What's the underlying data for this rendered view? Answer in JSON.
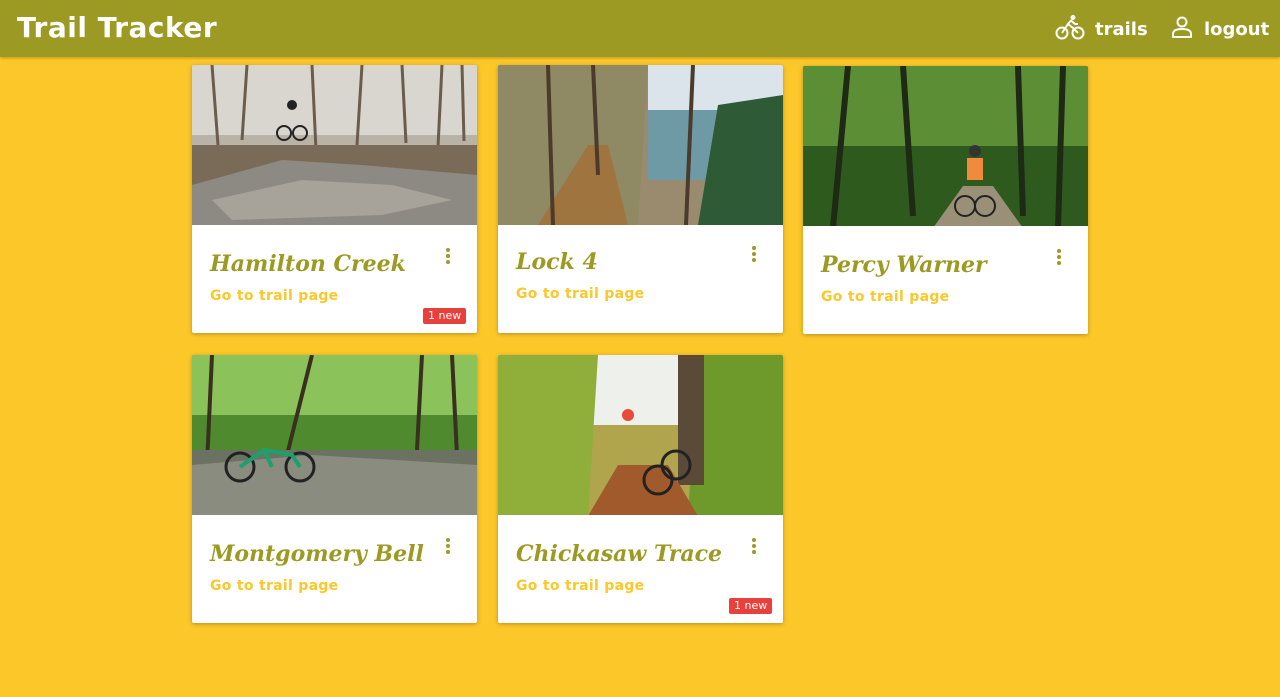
{
  "app": {
    "title": "Trail Tracker"
  },
  "nav": {
    "trails_label": "trails",
    "logout_label": "logout"
  },
  "colors": {
    "header": "#9c9a22",
    "background": "#fcc729",
    "trail_name": "#9c9a22",
    "link": "#fcc729",
    "badge": "#e8403b"
  },
  "cards": [
    {
      "name": "Hamilton Creek",
      "link": "Go to trail page",
      "badge": "1 new"
    },
    {
      "name": "Lock 4",
      "link": "Go to trail page",
      "badge": ""
    },
    {
      "name": "Percy Warner",
      "link": "Go to trail page",
      "badge": ""
    },
    {
      "name": "Montgomery Bell",
      "link": "Go to trail page",
      "badge": ""
    },
    {
      "name": "Chickasaw Trace",
      "link": "Go to trail page",
      "badge": "1 new"
    }
  ],
  "icons": {
    "trails": "bicycle-rider-icon",
    "logout": "user-icon",
    "card_menu": "more-vert-icon"
  }
}
